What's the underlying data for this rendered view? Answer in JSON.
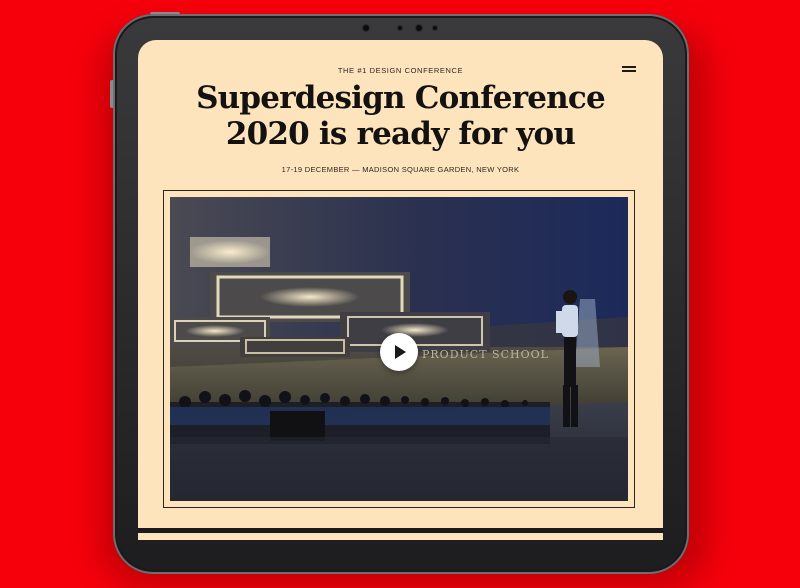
{
  "page": {
    "eyebrow": "THE #1 DESIGN CONFERENCE",
    "headline_line1": "Superdesign Conference",
    "headline_line2": "2020 is ready for you",
    "subline": "17-19 DECEMBER — MADISON SQUARE GARDEN, NEW YORK"
  },
  "media": {
    "banner_text": "PRODUCT SCHOOL"
  },
  "colors": {
    "background": "#f5000b",
    "screen": "#fde4bd",
    "text": "#141210"
  },
  "icons": {
    "menu": "hamburger-menu-icon",
    "play": "play-icon"
  }
}
